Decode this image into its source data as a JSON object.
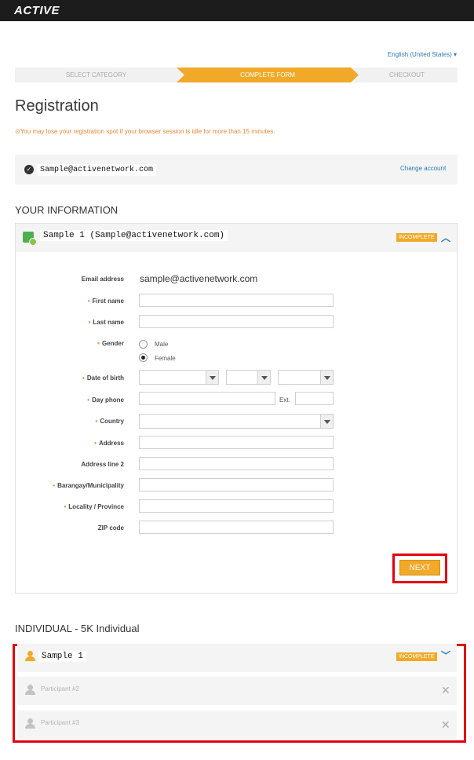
{
  "brand": {
    "logo": "ACTIVE"
  },
  "language": {
    "selected": "English (United States)"
  },
  "steps": [
    {
      "label": "SELECT CATEGORY",
      "state": "done"
    },
    {
      "label": "COMPLETE FORM",
      "state": "active"
    },
    {
      "label": "CHECKOUT",
      "state": "pending"
    }
  ],
  "page": {
    "title": "Registration",
    "warning": "You may lose your registration spot if your browser session is idle for more than 15 minutes."
  },
  "account": {
    "email": "Sample@activenetwork.com",
    "change_label": "Change account"
  },
  "your_info": {
    "heading": "YOUR INFORMATION",
    "participant": "Sample 1 (Sample@activenetwork.com)",
    "status_badge": "INCOMPLETE",
    "fields": {
      "email_label": "Email address",
      "email_value": "sample@activenetwork.com",
      "first_name": "First name",
      "last_name": "Last name",
      "gender": "Gender",
      "gender_male": "Male",
      "gender_female": "Female",
      "gender_selected": "Female",
      "dob": "Date of birth",
      "day_phone": "Day phone",
      "ext": "Ext.",
      "country": "Country",
      "address": "Address",
      "address2": "Address line 2",
      "barangay": "Barangay/Municipality",
      "locality": "Locality / Province",
      "zip": "ZIP code"
    },
    "next_label": "NEXT"
  },
  "individual": {
    "heading": "INDIVIDUAL - 5K Individual",
    "participants": [
      {
        "label": "Sample 1",
        "status": "INCOMPLETE"
      },
      {
        "label": "Participant #2"
      },
      {
        "label": "Participant #3"
      }
    ]
  },
  "colors": {
    "accent": "#f0a928",
    "link": "#2a7ab8",
    "highlight": "#e3000f",
    "warning": "#e4883c"
  }
}
